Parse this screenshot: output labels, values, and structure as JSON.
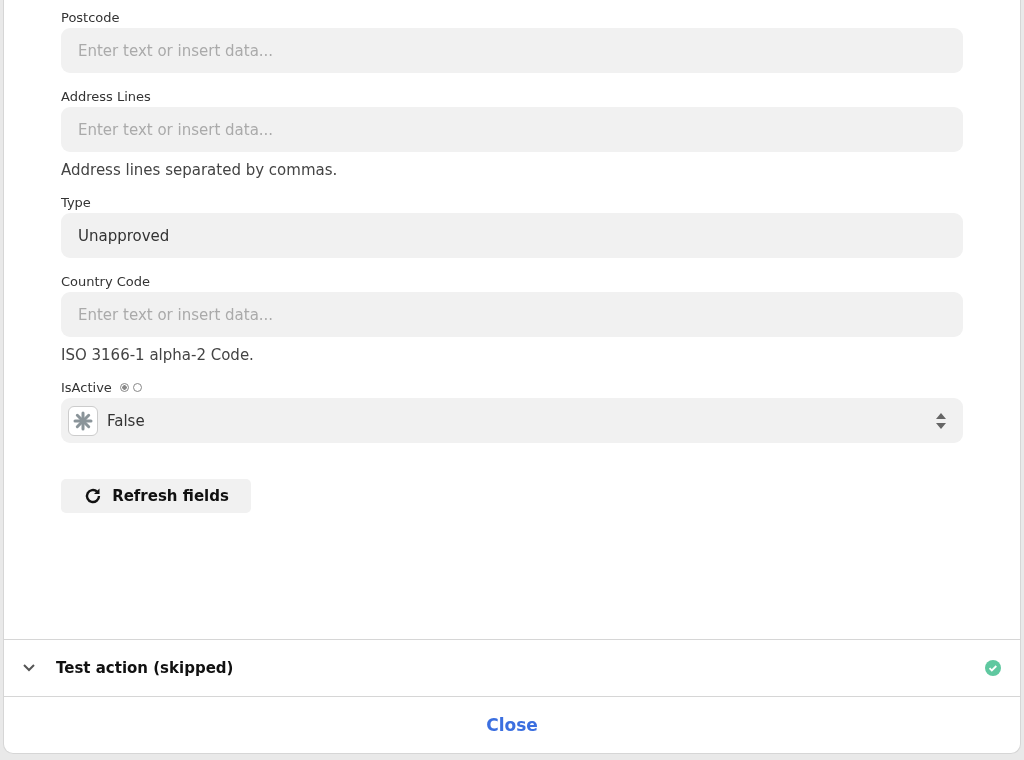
{
  "fields": [
    {
      "kind": "text",
      "label": "Postcode",
      "placeholder": "Enter text or insert data..."
    },
    {
      "kind": "text",
      "label": "Address Lines",
      "placeholder": "Enter text or insert data...",
      "help": "Address lines separated by commas."
    },
    {
      "kind": "value",
      "label": "Type",
      "value": "Unapproved"
    },
    {
      "kind": "text",
      "label": "Country Code",
      "placeholder": "Enter text or insert data...",
      "help": "ISO 3166-1 alpha-2 Code."
    },
    {
      "kind": "select",
      "label": "IsActive",
      "modes": [
        {
          "selected": true
        },
        {
          "selected": false
        }
      ],
      "value": "False"
    }
  ],
  "refresh_button": "Refresh fields",
  "test_section": {
    "title": "Test action (skipped)",
    "expanded": false,
    "complete": true
  },
  "close_button": "Close"
}
